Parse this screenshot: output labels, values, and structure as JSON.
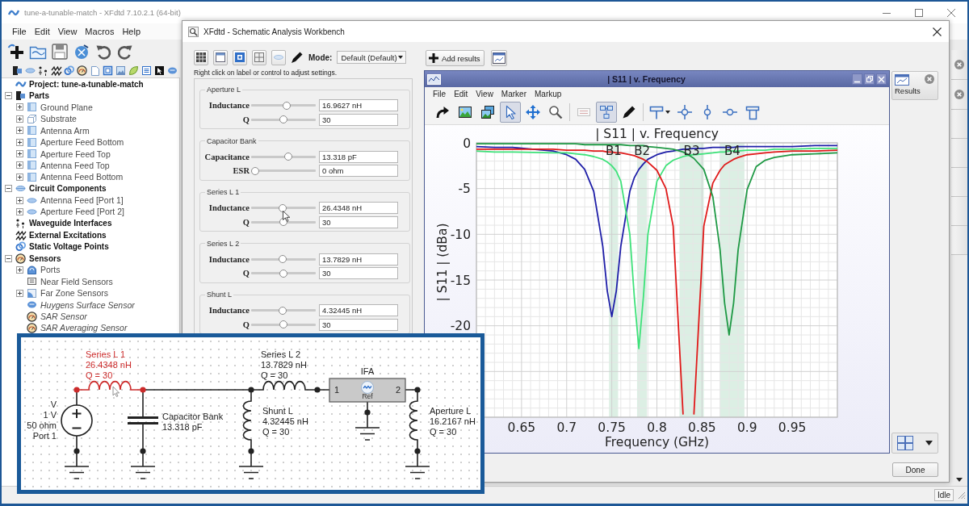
{
  "main_window": {
    "title": "tune-a-tunable-match - XFdtd 7.10.2.1 (64-bit)",
    "menu": [
      "File",
      "Edit",
      "View",
      "Macros",
      "Help"
    ],
    "tree": [
      {
        "kind": "project",
        "label": "Project: tune-a-tunable-match"
      },
      {
        "kind": "parts",
        "label": "Parts",
        "expanded": true,
        "children": [
          {
            "kind": "part",
            "label": "Ground Plane",
            "expanded": false
          },
          {
            "kind": "substrate",
            "label": "Substrate",
            "expanded": false
          },
          {
            "kind": "part",
            "label": "Antenna Arm",
            "expanded": false
          },
          {
            "kind": "part",
            "label": "Aperture Feed Bottom",
            "expanded": false
          },
          {
            "kind": "part",
            "label": "Aperture Feed Top",
            "expanded": false
          },
          {
            "kind": "part",
            "label": "Antenna Feed Top",
            "expanded": false
          },
          {
            "kind": "part",
            "label": "Antenna Feed Bottom",
            "expanded": false
          }
        ]
      },
      {
        "kind": "circuit",
        "label": "Circuit Components",
        "expanded": true,
        "children": [
          {
            "kind": "feed",
            "label": "Antenna Feed [Port 1]",
            "expanded": false
          },
          {
            "kind": "feed",
            "label": "Aperture Feed [Port 2]",
            "expanded": false
          }
        ]
      },
      {
        "kind": "waveguide",
        "label": "Waveguide Interfaces"
      },
      {
        "kind": "excitation",
        "label": "External Excitations"
      },
      {
        "kind": "voltage",
        "label": "Static Voltage Points"
      },
      {
        "kind": "sensor",
        "label": "Sensors",
        "expanded": true,
        "children": [
          {
            "kind": "port",
            "label": "Ports",
            "expanded": false,
            "inactive": false
          },
          {
            "kind": "near_field",
            "label": "Near Field Sensors",
            "inactive": false
          },
          {
            "kind": "far_zone",
            "label": "Far Zone Sensors",
            "expanded": false,
            "inactive": false
          },
          {
            "kind": "huygens",
            "label": "Huygens Surface Sensor",
            "inactive": true
          },
          {
            "kind": "sar",
            "label": "SAR Sensor",
            "inactive": true
          },
          {
            "kind": "sar",
            "label": "SAR Averaging Sensor",
            "inactive": true
          }
        ]
      }
    ],
    "status": "Idle"
  },
  "workbench": {
    "title": "XFdtd - Schematic Analysis Workbench",
    "mode_label": "Mode:",
    "mode_value": "Default (Default)",
    "add_results": "Add results",
    "hint": "Right click on label or control to adjust settings.",
    "groups": [
      {
        "title": "Aperture L",
        "rows": [
          {
            "label": "Inductance",
            "level": 0.55,
            "value": "16.9627 nH"
          },
          {
            "label": "Q",
            "level": 0.5,
            "value": "30"
          }
        ]
      },
      {
        "title": "Capacitor Bank",
        "rows": [
          {
            "label": "Capacitance",
            "level": 0.58,
            "value": "13.318 pF"
          },
          {
            "label": "ESR",
            "level": 0.0,
            "value": "0 ohm"
          }
        ]
      },
      {
        "title": "Series L 1",
        "rows": [
          {
            "label": "Inductance",
            "level": 0.49,
            "value": "26.4348 nH"
          },
          {
            "label": "Q",
            "level": 0.5,
            "value": "30"
          }
        ]
      },
      {
        "title": "Series L 2",
        "rows": [
          {
            "label": "Inductance",
            "level": 0.49,
            "value": "13.7829 nH"
          },
          {
            "label": "Q",
            "level": 0.5,
            "value": "30"
          }
        ]
      },
      {
        "title": "Shunt L",
        "rows": [
          {
            "label": "Inductance",
            "level": 0.49,
            "value": "4.32445 nH"
          },
          {
            "label": "Q",
            "level": 0.5,
            "value": "30"
          }
        ]
      }
    ],
    "results_tab": "Results",
    "done": "Done"
  },
  "plot_window": {
    "title": "| S11 | v. Frequency",
    "menu": [
      "File",
      "Edit",
      "View",
      "Marker",
      "Markup"
    ],
    "tool_groups": [
      [
        {
          "kind": "redo",
          "selected": false,
          "disabled": false
        },
        {
          "kind": "image",
          "selected": false,
          "disabled": false
        },
        {
          "kind": "images",
          "selected": false,
          "disabled": false
        },
        {
          "kind": "pointer",
          "selected": true,
          "disabled": false
        },
        {
          "kind": "pan",
          "selected": false,
          "disabled": false
        },
        {
          "kind": "zoom",
          "selected": false,
          "disabled": false
        }
      ],
      [
        {
          "kind": "legend",
          "selected": false,
          "disabled": true
        },
        {
          "kind": "network",
          "selected": true,
          "disabled": false
        },
        {
          "kind": "pen",
          "selected": false,
          "disabled": false
        }
      ],
      [
        {
          "kind": "marker",
          "selected": false,
          "disabled": false
        },
        {
          "kind": "point",
          "selected": false,
          "disabled": false
        },
        {
          "kind": "vline",
          "selected": false,
          "disabled": false
        },
        {
          "kind": "hline",
          "selected": false,
          "disabled": false
        },
        {
          "kind": "box",
          "selected": false,
          "disabled": false
        }
      ]
    ],
    "chart_data": {
      "type": "line",
      "title": "| S11 | v. Frequency",
      "xlabel": "Frequency (GHz)",
      "ylabel": "| S11 | (dBa)",
      "x": [
        0.6,
        0.62,
        0.64,
        0.685,
        0.7,
        0.71,
        0.72,
        0.73,
        0.74,
        0.745,
        0.75,
        0.755,
        0.76,
        0.77,
        0.775,
        0.78,
        0.785,
        0.79,
        0.8,
        0.81,
        0.818,
        0.829,
        0.833,
        0.841,
        0.852,
        0.862,
        0.87,
        0.875,
        0.88,
        0.885,
        0.89,
        0.9,
        0.91,
        0.92,
        0.93,
        0.95,
        0.975,
        1.0
      ],
      "series": [
        {
          "color": "#1f1fa8",
          "values": [
            -0.4,
            -0.5,
            -0.5,
            -0.9,
            -1.3,
            -1.8,
            -2.9,
            -5.3,
            -11.3,
            -16.2,
            -19.0,
            -16.2,
            -11.3,
            -5.3,
            -3.8,
            -2.9,
            -2.3,
            -1.8,
            -1.3,
            -1.0,
            -0.9,
            -0.7,
            -0.7,
            -0.6,
            -0.6,
            -0.5,
            -0.5,
            -0.5,
            -0.5,
            -0.5,
            -0.4,
            -0.4,
            -0.4,
            -0.4,
            -0.4,
            -0.4,
            -0.3,
            -0.3
          ]
        },
        {
          "color": "#3ee27a",
          "values": [
            -0.9,
            -1.0,
            -1.0,
            -1.1,
            -1.1,
            -1.2,
            -1.3,
            -1.5,
            -1.8,
            -2.1,
            -2.5,
            -3.1,
            -4.2,
            -10.0,
            -16.9,
            -22.5,
            -16.9,
            -10.0,
            -4.2,
            -2.5,
            -1.9,
            -1.5,
            -1.4,
            -1.3,
            -1.2,
            -1.1,
            -1.0,
            -1.0,
            -0.9,
            -0.9,
            -0.9,
            -0.8,
            -0.8,
            -0.8,
            -0.7,
            -0.7,
            -0.6,
            -0.6
          ]
        },
        {
          "color": "#e01a1a",
          "values": [
            -0.7,
            -0.7,
            -0.7,
            -0.7,
            -0.8,
            -0.8,
            -0.8,
            -0.9,
            -0.9,
            -1.0,
            -1.0,
            -1.1,
            -1.1,
            -1.3,
            -1.4,
            -1.6,
            -1.8,
            -2.1,
            -3.0,
            -5.0,
            -9.1,
            -29.7,
            null,
            -29.7,
            -9.1,
            -4.4,
            -3.0,
            -2.4,
            -2.1,
            -1.8,
            -1.6,
            -1.3,
            -1.2,
            -1.1,
            -1.0,
            -0.9,
            -0.9,
            -0.8
          ]
        },
        {
          "color": "#1f9945",
          "values": [
            -0.1,
            -0.1,
            -0.1,
            -0.1,
            -0.1,
            -0.1,
            -0.2,
            -0.2,
            -0.2,
            -0.2,
            -0.2,
            -0.2,
            -0.2,
            -0.3,
            -0.3,
            -0.3,
            -0.3,
            -0.4,
            -0.5,
            -0.6,
            -0.7,
            -1.0,
            -1.2,
            -1.7,
            -2.9,
            -5.9,
            -11.7,
            -17.5,
            -21.0,
            -17.5,
            -11.7,
            -5.1,
            -2.6,
            -1.9,
            -1.6,
            -1.3,
            -1.2,
            -1.1
          ]
        }
      ],
      "xlim": [
        0.6,
        1.0
      ],
      "ylim": [
        -30,
        0
      ],
      "xticks": [
        0.65,
        0.7,
        0.75,
        0.8,
        0.85,
        0.9,
        0.95
      ],
      "yticks": [
        0,
        -5,
        -10,
        -15,
        -20
      ],
      "grid": true,
      "bands": [
        {
          "axis": "x",
          "label": "B1",
          "from": 0.747,
          "to": 0.757
        },
        {
          "axis": "x",
          "label": "B2",
          "from": 0.778,
          "to": 0.789
        },
        {
          "axis": "x",
          "label": "B3",
          "from": 0.825,
          "to": 0.852
        },
        {
          "axis": "x",
          "label": "B4",
          "from": 0.87,
          "to": 0.897
        }
      ]
    }
  },
  "schematic": {
    "components": [
      {
        "kind": "inductor",
        "labels": [
          "Series L 1",
          "26.4348 nH",
          "Q = 30"
        ],
        "selected": true
      },
      {
        "kind": "inductor",
        "labels": [
          "Series L 2",
          "13.7829 nH",
          "Q = 30"
        ],
        "selected": false
      },
      {
        "kind": "block",
        "labels": [
          "IFA"
        ],
        "pins": [
          "1",
          "2"
        ],
        "icon_label": "Ref",
        "selected": false
      },
      {
        "kind": "source",
        "labels": [
          "V",
          "1 V",
          "50 ohm",
          "Port 1"
        ],
        "selected": false
      },
      {
        "kind": "capacitor",
        "labels": [
          "Capacitor Bank",
          "13.318 pF"
        ],
        "selected": false
      },
      {
        "kind": "inductor",
        "labels": [
          "Shunt L",
          "4.32445 nH",
          "Q = 30"
        ],
        "selected": false
      },
      {
        "kind": "inductor",
        "labels": [
          "Aperture L",
          "16.2167 nH",
          "Q = 30"
        ],
        "selected": false
      }
    ]
  }
}
